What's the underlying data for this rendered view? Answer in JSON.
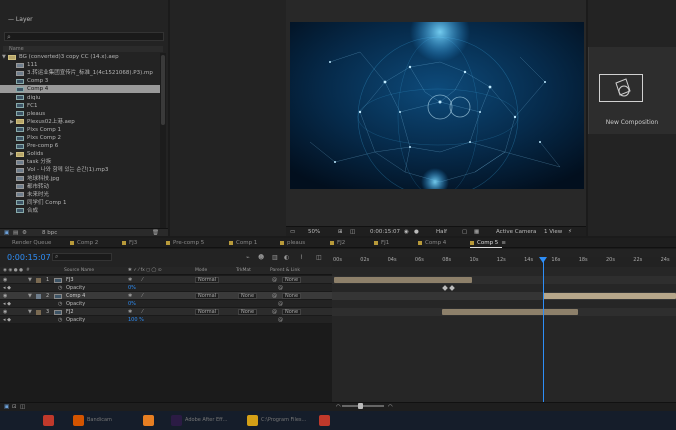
{
  "project": {
    "search_icon": "search-icon",
    "column_name": "Name",
    "items": [
      {
        "label": "BG (converted)3 copy CC (14.x).aep",
        "type": "folder",
        "indent": 0,
        "caret": "▼"
      },
      {
        "label": "111",
        "type": "footage",
        "indent": 1
      },
      {
        "label": "3.转运业集团宣传片_标准_1(4c1521068).P3).mp",
        "type": "footage",
        "indent": 1
      },
      {
        "label": "Comp 3",
        "type": "comp",
        "indent": 1
      },
      {
        "label": "Comp 4",
        "type": "comp",
        "indent": 1,
        "selected": true
      },
      {
        "label": "diqiu",
        "type": "comp",
        "indent": 1
      },
      {
        "label": "FC1",
        "type": "comp",
        "indent": 1
      },
      {
        "label": "pleaus",
        "type": "comp",
        "indent": 1
      },
      {
        "label": "Plexus02上港.aep",
        "type": "folder",
        "indent": 1,
        "caret": "▶"
      },
      {
        "label": "Plxs Comp 1",
        "type": "comp",
        "indent": 1
      },
      {
        "label": "Plxs Comp 2",
        "type": "comp",
        "indent": 1
      },
      {
        "label": "Pre-comp 6",
        "type": "comp",
        "indent": 1
      },
      {
        "label": "Solids",
        "type": "folder",
        "indent": 1,
        "caret": "▶"
      },
      {
        "label": "task 分拆",
        "type": "footage",
        "indent": 1
      },
      {
        "label": "Vol - 나와 함께 있는 순간(1).mp3",
        "type": "footage",
        "indent": 1
      },
      {
        "label": "地球科技.jpg",
        "type": "footage",
        "indent": 1
      },
      {
        "label": "都市转动",
        "type": "footage",
        "indent": 1
      },
      {
        "label": "未来时光",
        "type": "footage",
        "indent": 1
      },
      {
        "label": "同学们 Comp 1",
        "type": "comp",
        "indent": 1
      },
      {
        "label": "合成",
        "type": "comp",
        "indent": 1
      }
    ],
    "footer_bpc": "8 bpc"
  },
  "layer_panel": {
    "title": "Layer"
  },
  "viewer": {
    "bar": {
      "zoom": "50%",
      "timecode": "0:00:15:07",
      "resolution": "Half",
      "camera": "Active Camera",
      "view": "1 View"
    }
  },
  "right_panel": {
    "new_composition": "New Composition"
  },
  "tabs": [
    {
      "label": "Render Queue",
      "sq": false
    },
    {
      "label": "Comp 2",
      "sq": true
    },
    {
      "label": "FJ3",
      "sq": true
    },
    {
      "label": "Pre-comp 5",
      "sq": true
    },
    {
      "label": "Comp 1",
      "sq": true
    },
    {
      "label": "pleaus",
      "sq": true
    },
    {
      "label": "FJ2",
      "sq": true
    },
    {
      "label": "FJ1",
      "sq": true
    },
    {
      "label": "Comp 4",
      "sq": true
    },
    {
      "label": "Comp 5",
      "sq": true,
      "active": true,
      "close": "≡"
    }
  ],
  "timeline": {
    "timecode": "0:00:15:07",
    "search_icon": "search-icon",
    "columns": {
      "source": "Source Name",
      "mode": "Mode",
      "trkmat": "TrkMat",
      "parent": "Parent & Link"
    },
    "ruler": [
      "00s",
      "02s",
      "04s",
      "06s",
      "08s",
      "10s",
      "12s",
      "14s",
      "16s",
      "18s",
      "20s",
      "22s",
      "24s"
    ],
    "layers": [
      {
        "kind": "layer",
        "num": "1",
        "name": "FJ3",
        "mode": "Normal",
        "trkmat": "",
        "parent": "None",
        "label_color": "#7a6a52"
      },
      {
        "kind": "prop",
        "name": "Opacity",
        "value": "0%"
      },
      {
        "kind": "layer",
        "num": "2",
        "name": "Comp 4",
        "mode": "Normal",
        "trkmat": "None",
        "parent": "None",
        "label_color": "#6e7d8c",
        "selected": true
      },
      {
        "kind": "prop",
        "name": "Opacity",
        "value": "0%"
      },
      {
        "kind": "layer",
        "num": "3",
        "name": "FJ2",
        "mode": "Normal",
        "trkmat": "None",
        "parent": "None",
        "label_color": "#7a6a52"
      },
      {
        "kind": "prop",
        "name": "Opacity",
        "value": "100 %"
      }
    ]
  },
  "colors": {
    "accent": "#2e8ef7",
    "bar_tan": "#9b8b6e",
    "bar_tan2": "#a6977a"
  },
  "taskbar": {
    "items": [
      {
        "icon": "app-icon-red"
      },
      {
        "icon": "app-icon-orange",
        "label": "Bandicam"
      },
      {
        "icon": "app-icon-orange2"
      },
      {
        "icon": "after-effects-icon",
        "label": "Adobe After Eff..."
      },
      {
        "icon": "folder-icon",
        "label": "C:\\Program Files..."
      },
      {
        "icon": "app-icon-red2"
      }
    ]
  }
}
